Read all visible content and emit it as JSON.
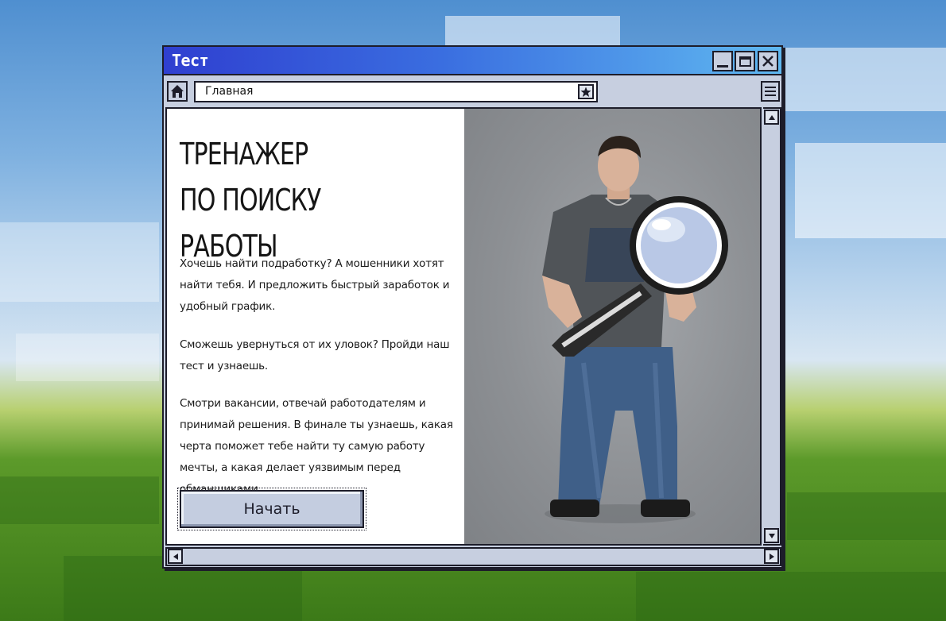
{
  "window": {
    "title": "Тест"
  },
  "toolbar": {
    "address": "Главная",
    "home_icon": "home-icon",
    "bookmark_icon": "star-icon",
    "menu_icon": "hamburger-icon"
  },
  "content": {
    "headline_line1": "ТРЕНАЖЕР",
    "headline_line2": "ПО ПОИСКУ РАБОТЫ",
    "paragraph1": "Хочешь найти подработку? А мошенники хотят найти тебя. И предложить быстрый заработок и удобный график.",
    "paragraph2": "Сможешь увернуться от их уловок? Пройди наш тест и узнаешь.",
    "paragraph3": "Смотри вакансии, отвечай работодателям и принимай решения. В финале ты узнаешь, какая черта поможет тебе найти ту самую работу мечты, а какая делает уязвимым перед обманщиками.",
    "start_button": "Начать"
  },
  "colors": {
    "title_gradient_start": "#2f3fd0",
    "title_gradient_end": "#5fb8f0",
    "chrome": "#c7cfe0",
    "button": "#c4cde0"
  }
}
